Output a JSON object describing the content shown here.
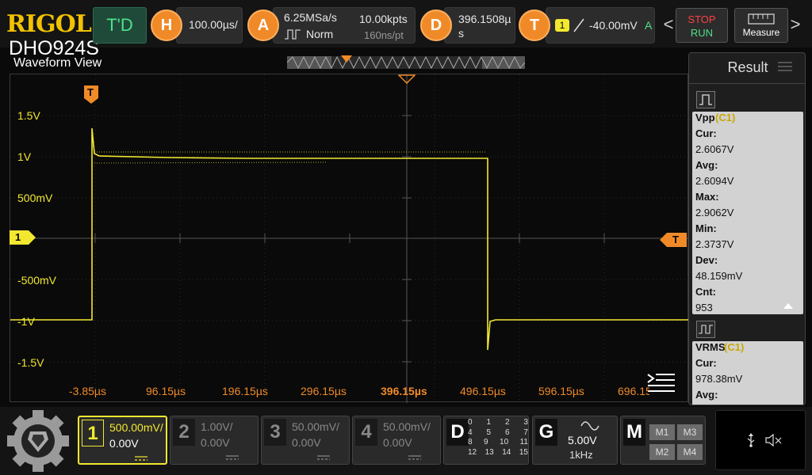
{
  "header": {
    "brand": "RIGOL",
    "model": "DHO924S",
    "td_label": "T'D",
    "horizontal": {
      "icon_label": "H",
      "timebase": "100.00µs/"
    },
    "acquire": {
      "icon_label": "A",
      "sample_rate": "6.25MSa/s",
      "memory_depth": "10.00kpts",
      "mode": "Norm",
      "sample_interval": "160ns/pt"
    },
    "delay": {
      "icon_label": "D",
      "value_line1": "396.1508µ",
      "value_line2": "s"
    },
    "trigger": {
      "icon_label": "T",
      "source": "1",
      "level": "-40.00mV",
      "mode": "A"
    },
    "stop_label": "STOP",
    "run_label": "RUN",
    "measure_label": "Measure",
    "prev_arrow": "<",
    "next_arrow": ">"
  },
  "waveform": {
    "title": "Waveform View",
    "trigger_marker": "T",
    "channel_marker": "1",
    "trigger_level_marker": "T",
    "y_labels": [
      "1.5V",
      "1V",
      "500mV",
      "-500mV",
      "-1V",
      "-1.5V"
    ],
    "x_labels": [
      "-3.85µs",
      "96.15µs",
      "196.15µs",
      "296.15µs",
      "396.15µs",
      "496.15µs",
      "596.15µs",
      "696.15µs"
    ]
  },
  "result": {
    "title": "Result",
    "measurements": [
      {
        "name": "Vpp",
        "source": "(C1)",
        "lines": [
          "Cur:",
          "2.6067V",
          "Avg:",
          "2.6094V",
          "Max:",
          "2.9062V",
          "Min:",
          "2.3737V",
          "Dev:",
          "48.159mV",
          "Cnt:",
          "953"
        ]
      },
      {
        "name": "VRMS",
        "source": "(C1)",
        "lines": [
          "Cur:",
          "978.38mV",
          "Avg:"
        ]
      }
    ]
  },
  "channels": [
    {
      "num": "1",
      "scale": "500.00mV/",
      "offset": "0.00V",
      "active": true,
      "color": "#f2e830"
    },
    {
      "num": "2",
      "scale": "1.00V/",
      "offset": "0.00V",
      "active": false,
      "color": "#888888"
    },
    {
      "num": "3",
      "scale": "50.00mV/",
      "offset": "0.00V",
      "active": false,
      "color": "#888888"
    },
    {
      "num": "4",
      "scale": "50.00mV/",
      "offset": "0.00V",
      "active": false,
      "color": "#888888"
    }
  ],
  "digital": {
    "label": "D",
    "rows": [
      [
        "0",
        "1",
        "2",
        "3"
      ],
      [
        "4",
        "5",
        "6",
        "7"
      ],
      [
        "8",
        "9",
        "10",
        "11"
      ],
      [
        "12",
        "13",
        "14",
        "15"
      ]
    ]
  },
  "generator": {
    "label": "G",
    "amplitude": "5.00V",
    "frequency": "1kHz"
  },
  "math": {
    "label": "M",
    "items": [
      "M1",
      "M3",
      "M2",
      "M4"
    ]
  },
  "colors": {
    "ch1": "#f2e830",
    "accent": "#f08a28",
    "run": "#4fe08a",
    "stop": "#ff4040"
  },
  "waveform_trace": {
    "description_units": "divisions",
    "low_level": -1.0,
    "high_level": 1.0
  }
}
